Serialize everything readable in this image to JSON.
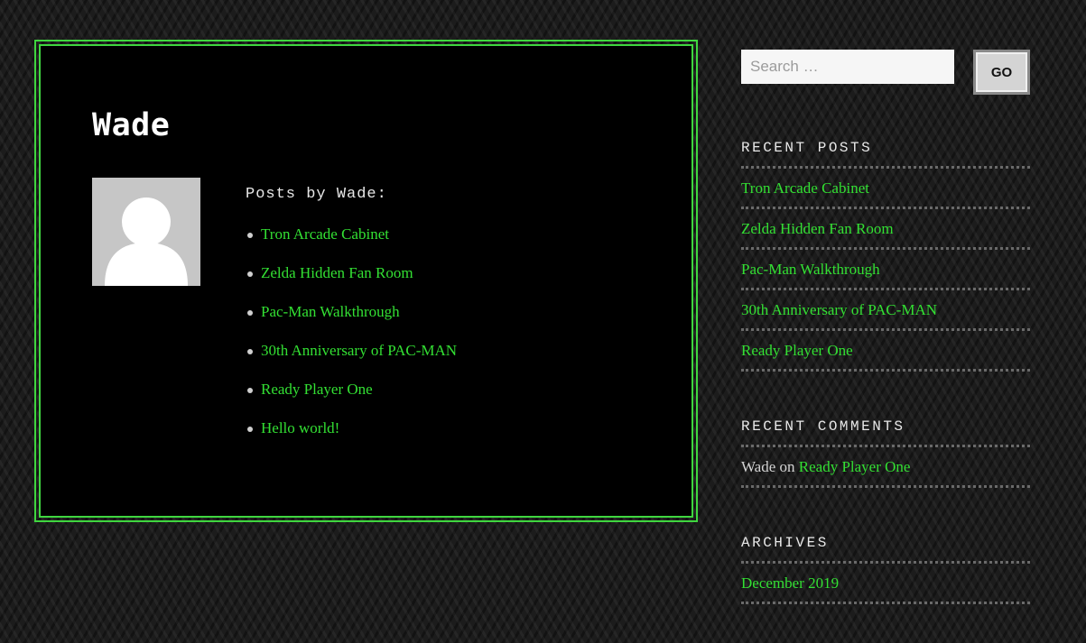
{
  "author": {
    "name": "Wade",
    "posts_heading": "Posts by Wade:",
    "posts": [
      "Tron Arcade Cabinet",
      "Zelda Hidden Fan Room",
      "Pac-Man Walkthrough",
      "30th Anniversary of PAC-MAN",
      "Ready Player One",
      "Hello world!"
    ]
  },
  "sidebar": {
    "search": {
      "placeholder": "Search …",
      "value": "",
      "button_label": "GO"
    },
    "recent_posts": {
      "title": "RECENT POSTS",
      "items": [
        "Tron Arcade Cabinet",
        "Zelda Hidden Fan Room",
        "Pac-Man Walkthrough",
        "30th Anniversary of PAC-MAN",
        "Ready Player One"
      ]
    },
    "recent_comments": {
      "title": "RECENT COMMENTS",
      "items": [
        {
          "author": "Wade",
          "on": "on",
          "post": "Ready Player One"
        }
      ]
    },
    "archives": {
      "title": "ARCHIVES",
      "items": [
        "December 2019"
      ]
    }
  },
  "colors": {
    "accent": "#33e033",
    "card_border": "#3fd63f",
    "card_background": "#000000"
  },
  "icons": {
    "avatar": "default-user-avatar-icon",
    "bullet": "bullet-dot-icon"
  }
}
